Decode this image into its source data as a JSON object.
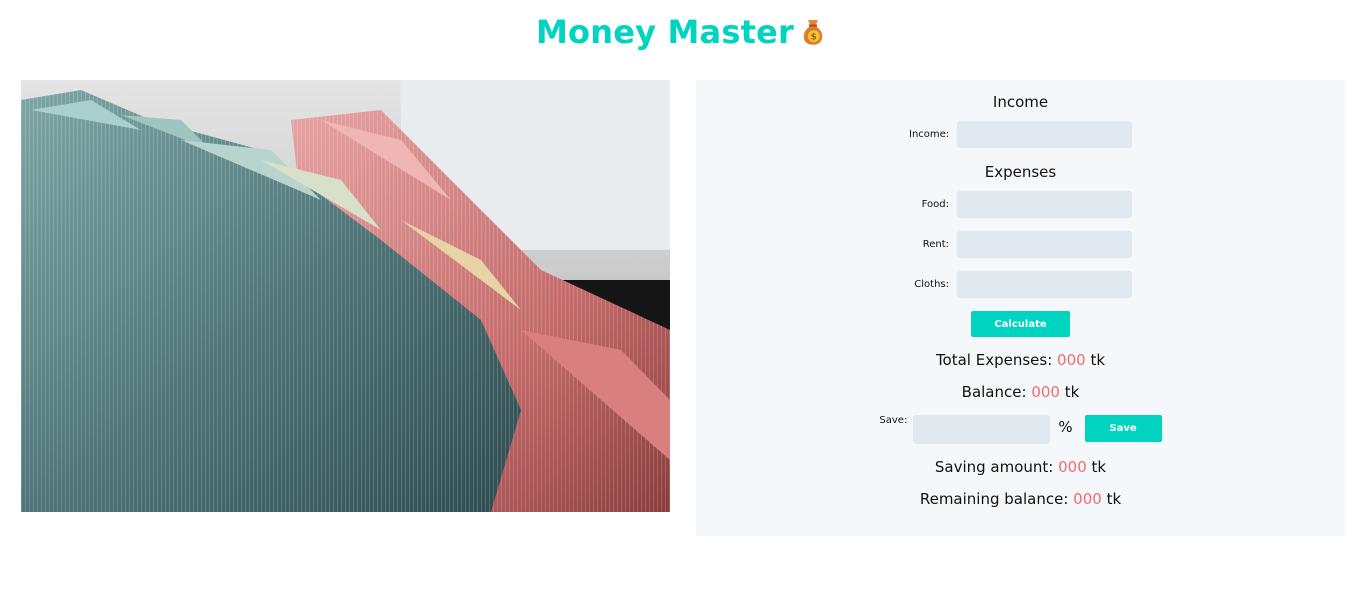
{
  "header": {
    "title": "Money Master",
    "icon": "money-bag-icon"
  },
  "image": {
    "subject": "stacks of banknotes"
  },
  "income_section": {
    "title": "Income",
    "income_label": "Income:",
    "income_value": ""
  },
  "expenses_section": {
    "title": "Expenses",
    "food_label": "Food:",
    "food_value": "",
    "rent_label": "Rent:",
    "rent_value": "",
    "cloths_label": "Cloths:",
    "cloths_value": "",
    "calculate_label": "Calculate"
  },
  "totals": {
    "total_label": "Total Expenses:",
    "total_value": "000",
    "total_unit": "tk",
    "balance_label": "Balance:",
    "balance_value": "000",
    "balance_unit": "tk"
  },
  "saving": {
    "save_label": "Save:",
    "percent_symbol": "%",
    "save_button": "Save",
    "saving_amount_label": "Saving amount:",
    "saving_amount_value": "000",
    "saving_unit": "tk",
    "remaining_label": "Remaining balance:",
    "remaining_value": "000",
    "remaining_unit": "tk"
  },
  "colors": {
    "accent": "#00d3c0",
    "value_red": "#f06b6b",
    "panel_bg": "#f5f8fb",
    "input_bg": "#e2e8f0"
  }
}
